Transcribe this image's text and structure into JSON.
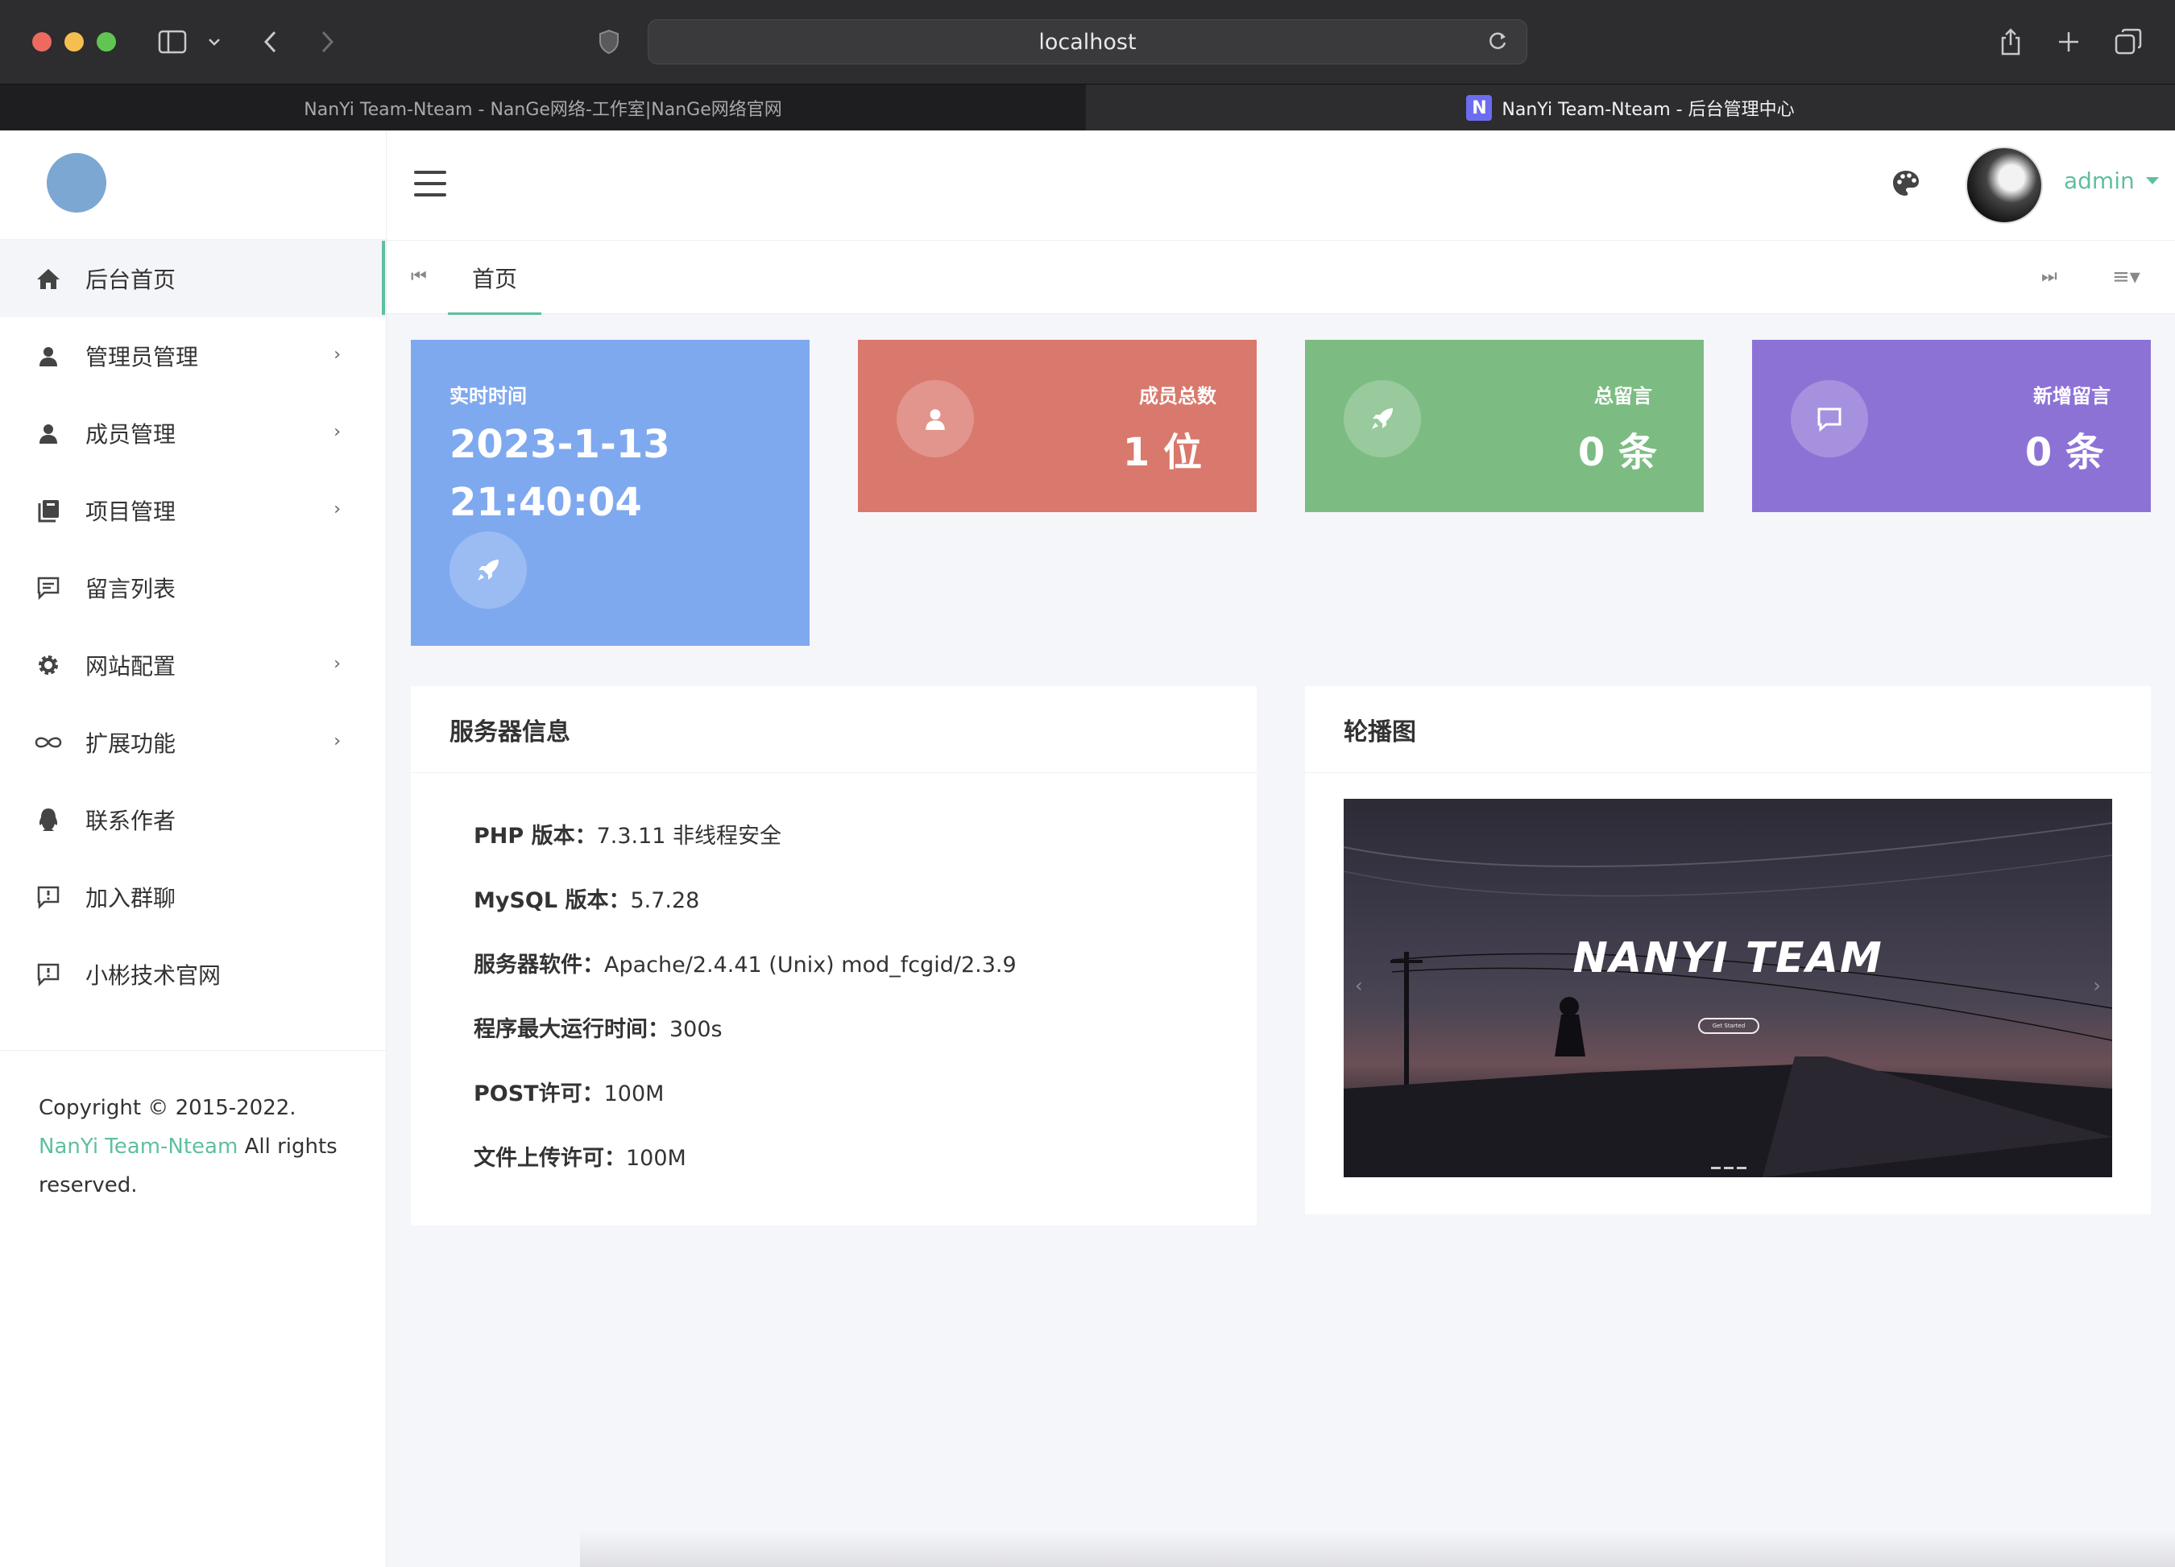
{
  "browser": {
    "url": "localhost",
    "tabs": [
      {
        "title": "NanYi Team-Nteam - NanGe网络-工作室|NanGe网络官网"
      },
      {
        "title": "NanYi Team-Nteam - 后台管理中心",
        "favicon": "N"
      }
    ]
  },
  "sidebar": {
    "items": [
      {
        "label": "后台首页",
        "icon": "home-icon"
      },
      {
        "label": "管理员管理",
        "icon": "user-icon"
      },
      {
        "label": "成员管理",
        "icon": "user-icon"
      },
      {
        "label": "项目管理",
        "icon": "book-icon"
      },
      {
        "label": "留言列表",
        "icon": "message-icon"
      },
      {
        "label": "网站配置",
        "icon": "gear-icon"
      },
      {
        "label": "扩展功能",
        "icon": "infinity-icon"
      },
      {
        "label": "联系作者",
        "icon": "qq-icon"
      },
      {
        "label": "加入群聊",
        "icon": "alert-message-icon"
      },
      {
        "label": "小彬技术官网",
        "icon": "alert-message-icon"
      }
    ],
    "copyright_prefix": "Copyright © 2015-2022. ",
    "copyright_link": "NanYi Team-Nteam",
    "copyright_suffix": " All rights reserved."
  },
  "header": {
    "user_name": "admin"
  },
  "tabrow": {
    "current_tab": "首页"
  },
  "stats": {
    "time": {
      "label": "实时时间",
      "date": "2023-1-13",
      "clock": "21:40:04"
    },
    "members": {
      "label": "成员总数",
      "value": "1 位"
    },
    "messages": {
      "label": "总留言",
      "value": "0 条"
    },
    "new_messages": {
      "label": "新增留言",
      "value": "0 条"
    }
  },
  "server_info": {
    "title": "服务器信息",
    "rows": [
      {
        "key": "PHP 版本：",
        "value": "7.3.11 非线程安全"
      },
      {
        "key": "MySQL 版本：",
        "value": "5.7.28"
      },
      {
        "key": "服务器软件：",
        "value": "Apache/2.4.41 (Unix) mod_fcgid/2.3.9"
      },
      {
        "key": "程序最大运行时间：",
        "value": "300s"
      },
      {
        "key": "POST许可：",
        "value": "100M"
      },
      {
        "key": "文件上传许可：",
        "value": "100M"
      }
    ]
  },
  "carousel": {
    "title": "轮播图",
    "slide_title": "NANYI TEAM",
    "slide_button": "Get Started"
  },
  "colors": {
    "accent": "#5fbf9e",
    "time_card": "#7fa9ef",
    "members_card": "#d9786c",
    "messages_card": "#7cbc82",
    "new_messages_card": "#8d72d6"
  }
}
